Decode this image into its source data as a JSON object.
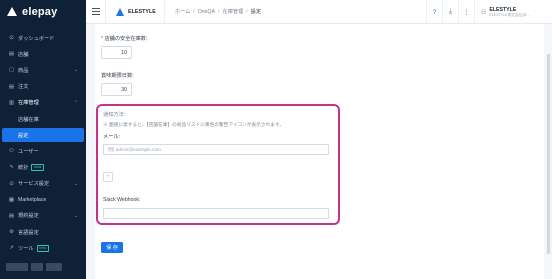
{
  "brand": {
    "name": "elepay"
  },
  "sidebar": {
    "items": [
      {
        "icon": "⊙",
        "label": "ダッシュボード",
        "chevron": ""
      },
      {
        "icon": "▤",
        "label": "店舗",
        "chevron": ""
      },
      {
        "icon": "▢",
        "label": "商品",
        "chevron": "⌄"
      },
      {
        "icon": "▤",
        "label": "注文",
        "chevron": ""
      },
      {
        "icon": "▥",
        "label": "在庫管理",
        "chevron": "⌃"
      },
      {
        "icon": "",
        "label": "店舗在庫",
        "chevron": ""
      },
      {
        "icon": "",
        "label": "設定",
        "chevron": ""
      },
      {
        "icon": "⚇",
        "label": "ユーザー",
        "chevron": ""
      },
      {
        "icon": "∿",
        "label": "統計",
        "badge": "beta",
        "chevron": ""
      },
      {
        "icon": "⊙",
        "label": "サービス設定",
        "chevron": "⌄"
      },
      {
        "icon": "▦",
        "label": "Marketplace",
        "chevron": ""
      },
      {
        "icon": "▤",
        "label": "規約設定",
        "chevron": "⌄"
      },
      {
        "icon": "⊚",
        "label": "言語設定",
        "chevron": ""
      },
      {
        "icon": "↗",
        "label": "ツール",
        "badge": "beta",
        "chevron": ""
      }
    ]
  },
  "header": {
    "app_name": "ELESTYLE",
    "breadcrumb": [
      "ホーム",
      "OneQA",
      "在庫管理",
      "設定"
    ],
    "help_icon": "?",
    "download_icon": "⤓",
    "more_icon": "⋮",
    "account": {
      "icon": "⚇",
      "name": "ELESTYLE",
      "sub": "ELESTYLE株式会社(本..."
    }
  },
  "form": {
    "safety_stock_label": "店舗の安全在庫数:",
    "safety_stock_value": "10",
    "expiry_days_label": "賞味期限日数:",
    "expiry_days_value": "30",
    "notify_title": "通知方法:",
    "notify_help": "※ 圏値に達すると、【店舗在庫】の商品リストに黄色の警告アイコンが表示されます。",
    "email_label": "メール:",
    "email_placeholder": "例) admin@example.com",
    "add_icon": "+",
    "slack_label": "Slack Webhook:",
    "slack_value": "",
    "save_label": "保 存"
  },
  "colors": {
    "sidebar_bg": "#0f2137",
    "accent": "#1a73e8",
    "highlight_border": "#cc2f86",
    "beta_badge": "#36c3a4"
  }
}
